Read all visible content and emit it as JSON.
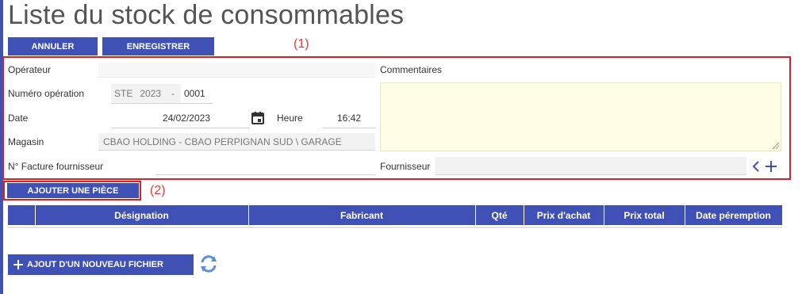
{
  "page": {
    "title": "Liste du stock de consommables"
  },
  "toolbar": {
    "cancel_label": "ANNULER",
    "save_label": "ENREGISTRER"
  },
  "annotations": {
    "one": "(1)",
    "two": "(2)"
  },
  "form": {
    "operator_label": "Opérateur",
    "operator_value": "",
    "operation_number_label": "Numéro opération",
    "operation_prefix": "STE",
    "operation_year": "2023",
    "operation_separator": "-",
    "operation_seq": "0001",
    "date_label": "Date",
    "date_value": "24/02/2023",
    "time_label": "Heure",
    "time_value": "16:42",
    "store_label": "Magasin",
    "store_value": "CBAO HOLDING - CBAO PERPIGNAN SUD \\ GARAGE",
    "invoice_label": "N° Facture fournisseur",
    "invoice_value": "",
    "comments_label": "Commentaires",
    "comments_value": "",
    "supplier_label": "Fournisseur",
    "supplier_value": ""
  },
  "add_part_label": "AJOUTER UNE PIÈCE",
  "table": {
    "columns": [
      "",
      "Désignation",
      "Fabricant",
      "Qté",
      "Prix d'achat",
      "Prix total",
      "Date péremption"
    ]
  },
  "add_file_label": "AJOUT D'UN NOUVEAU FICHIER",
  "icons": {
    "calendar": "calendar-icon",
    "chevron_left": "chevron-left-icon",
    "plus": "plus-icon",
    "refresh": "refresh-icon"
  },
  "colors": {
    "primary": "#3f51b5",
    "annotation": "#e02020",
    "textarea_bg": "#fffde3"
  }
}
